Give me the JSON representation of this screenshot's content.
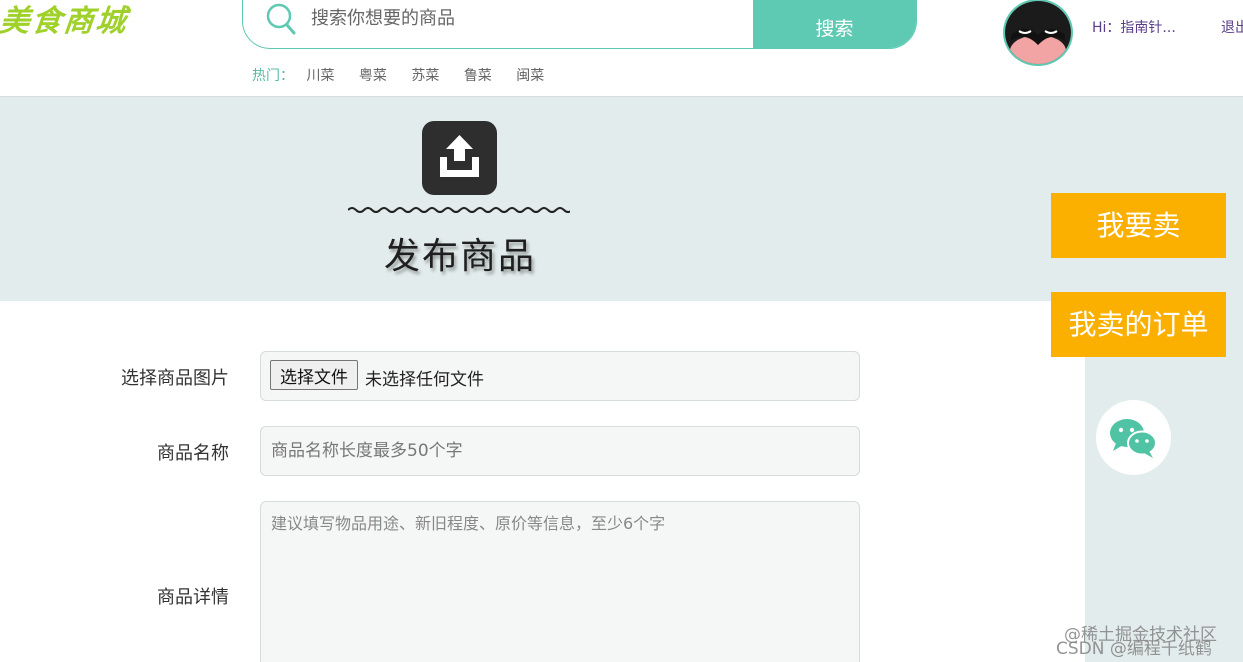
{
  "header": {
    "logo_text": "美食商城",
    "search": {
      "placeholder": "搜索你想要的商品",
      "button_label": "搜索"
    },
    "hot": {
      "label": "热门：",
      "items": [
        "川菜",
        "粤菜",
        "苏菜",
        "鲁菜",
        "闽菜"
      ]
    },
    "user": {
      "greeting": "Hi：指南针...",
      "logout_label": "退出"
    }
  },
  "banner": {
    "title": "发布商品"
  },
  "side": {
    "sell_label": "我要卖",
    "orders_label": "我卖的订单"
  },
  "form": {
    "image": {
      "label": "选择商品图片",
      "button_label": "选择文件",
      "status": "未选择任何文件"
    },
    "name": {
      "label": "商品名称",
      "placeholder": "商品名称长度最多50个字"
    },
    "detail": {
      "label": "商品详情",
      "placeholder": "建议填写物品用途、新旧程度、原价等信息，至少6个字"
    }
  },
  "watermark": {
    "line1": "@稀土掘金技术社区",
    "line2": "CSDN @编程千纸鹤"
  },
  "colors": {
    "accent": "#5fcab4",
    "side_button": "#fbb000",
    "banner_bg": "#e3ecec"
  }
}
